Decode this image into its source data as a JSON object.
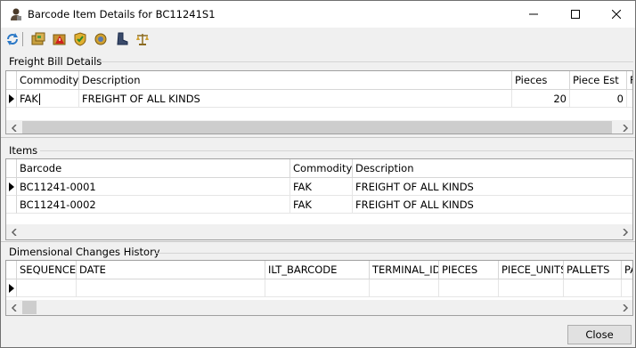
{
  "window": {
    "title": "Barcode Item Details for BC11241S1",
    "minimize_label": "—",
    "maximize_label": "☐",
    "close_label": "✕"
  },
  "toolbar": {
    "icons": [
      "refresh-icon",
      "package-icon",
      "box-warning-icon",
      "shield-icon",
      "badge-icon",
      "boot-icon",
      "scale-icon"
    ]
  },
  "freight": {
    "section_label": "Freight Bill Details",
    "columns": [
      "Commodity",
      "Description",
      "Pieces",
      "Piece Est",
      "F"
    ],
    "rows": [
      {
        "commodity": "FAK",
        "description": "FREIGHT OF ALL KINDS",
        "pieces": "20",
        "piece_est": "0",
        "extra": ""
      }
    ]
  },
  "items": {
    "section_label": "Items",
    "columns": [
      "Barcode",
      "Commodity",
      "Description"
    ],
    "rows": [
      {
        "barcode": "BC11241-0001",
        "commodity": "FAK",
        "description": "FREIGHT OF ALL KINDS"
      },
      {
        "barcode": "BC11241-0002",
        "commodity": "FAK",
        "description": "FREIGHT OF ALL KINDS"
      }
    ]
  },
  "history": {
    "section_label": "Dimensional Changes History",
    "columns": [
      "SEQUENCE",
      "DATE",
      "ILT_BARCODE",
      "TERMINAL_ID",
      "PIECES",
      "PIECE_UNITS",
      "PALLETS",
      "PA"
    ]
  },
  "footer": {
    "close_label": "Close"
  }
}
